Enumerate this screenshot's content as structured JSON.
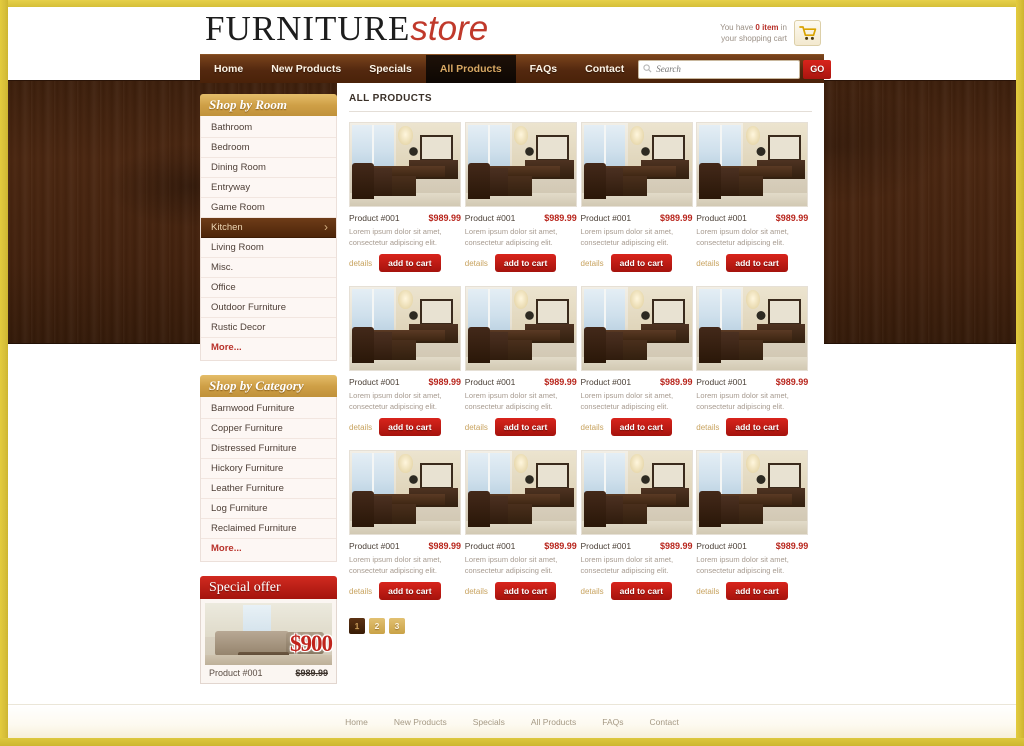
{
  "brand": {
    "part1": "FURNITURE",
    "part2": "store"
  },
  "cart": {
    "prefix": "You have",
    "count": "0 item",
    "suffix": "in your shopping cart",
    "icon": "shopping-cart-icon"
  },
  "nav": {
    "items": [
      {
        "label": "Home",
        "active": false
      },
      {
        "label": "New Products",
        "active": false
      },
      {
        "label": "Specials",
        "active": false
      },
      {
        "label": "All Products",
        "active": true
      },
      {
        "label": "FAQs",
        "active": false
      },
      {
        "label": "Contact",
        "active": false
      }
    ]
  },
  "search": {
    "placeholder": "Search",
    "value": "",
    "button": "GO",
    "icon": "magnifier-icon"
  },
  "sidebar": {
    "shop_by_room": {
      "title": "Shop by Room",
      "items": [
        {
          "label": "Bathroom",
          "active": false
        },
        {
          "label": "Bedroom",
          "active": false
        },
        {
          "label": "Dining Room",
          "active": false
        },
        {
          "label": "Entryway",
          "active": false
        },
        {
          "label": "Game Room",
          "active": false
        },
        {
          "label": "Kitchen",
          "active": true
        },
        {
          "label": "Living Room",
          "active": false
        },
        {
          "label": "Misc.",
          "active": false
        },
        {
          "label": "Office",
          "active": false
        },
        {
          "label": "Outdoor Furniture",
          "active": false
        },
        {
          "label": "Rustic Decor",
          "active": false
        },
        {
          "label": "More...",
          "active": false,
          "more": true
        }
      ]
    },
    "shop_by_category": {
      "title": "Shop by Category",
      "items": [
        {
          "label": "Barnwood Furniture",
          "active": false
        },
        {
          "label": "Copper Furniture",
          "active": false
        },
        {
          "label": "Distressed Furniture",
          "active": false
        },
        {
          "label": "Hickory Furniture",
          "active": false
        },
        {
          "label": "Leather Furniture",
          "active": false
        },
        {
          "label": "Log Furniture",
          "active": false
        },
        {
          "label": "Reclaimed Furniture",
          "active": false
        },
        {
          "label": "More...",
          "active": false,
          "more": true
        }
      ]
    },
    "special_offer": {
      "title": "Special offer",
      "sale_price": "$900",
      "product": "Product #001",
      "old_price": "$989.99",
      "image": "sofa-livingroom-photo"
    }
  },
  "content": {
    "title": "ALL PRODUCTS",
    "product_defaults": {
      "name": "Product #001",
      "price": "$989.99",
      "description": "Lorem ipsum dolor sit amet, consectetur adipiscing elit.",
      "details_label": "details",
      "cart_label": "add to cart",
      "image": "dining-room-photo"
    },
    "products": [
      {
        "name": "Product #001",
        "price": "$989.99",
        "description": "Lorem ipsum dolor sit amet, consectetur adipiscing elit.",
        "details_label": "details",
        "cart_label": "add to cart"
      },
      {
        "name": "Product #001",
        "price": "$989.99",
        "description": "Lorem ipsum dolor sit amet, consectetur adipiscing elit.",
        "details_label": "details",
        "cart_label": "add to cart"
      },
      {
        "name": "Product #001",
        "price": "$989.99",
        "description": "Lorem ipsum dolor sit amet, consectetur adipiscing elit.",
        "details_label": "details",
        "cart_label": "add to cart"
      },
      {
        "name": "Product #001",
        "price": "$989.99",
        "description": "Lorem ipsum dolor sit amet, consectetur adipiscing elit.",
        "details_label": "details",
        "cart_label": "add to cart"
      },
      {
        "name": "Product #001",
        "price": "$989.99",
        "description": "Lorem ipsum dolor sit amet, consectetur adipiscing elit.",
        "details_label": "details",
        "cart_label": "add to cart"
      },
      {
        "name": "Product #001",
        "price": "$989.99",
        "description": "Lorem ipsum dolor sit amet, consectetur adipiscing elit.",
        "details_label": "details",
        "cart_label": "add to cart"
      },
      {
        "name": "Product #001",
        "price": "$989.99",
        "description": "Lorem ipsum dolor sit amet, consectetur adipiscing elit.",
        "details_label": "details",
        "cart_label": "add to cart"
      },
      {
        "name": "Product #001",
        "price": "$989.99",
        "description": "Lorem ipsum dolor sit amet, consectetur adipiscing elit.",
        "details_label": "details",
        "cart_label": "add to cart"
      },
      {
        "name": "Product #001",
        "price": "$989.99",
        "description": "Lorem ipsum dolor sit amet, consectetur adipiscing elit.",
        "details_label": "details",
        "cart_label": "add to cart"
      },
      {
        "name": "Product #001",
        "price": "$989.99",
        "description": "Lorem ipsum dolor sit amet, consectetur adipiscing elit.",
        "details_label": "details",
        "cart_label": "add to cart"
      },
      {
        "name": "Product #001",
        "price": "$989.99",
        "description": "Lorem ipsum dolor sit amet, consectetur adipiscing elit.",
        "details_label": "details",
        "cart_label": "add to cart"
      },
      {
        "name": "Product #001",
        "price": "$989.99",
        "description": "Lorem ipsum dolor sit amet, consectetur adipiscing elit.",
        "details_label": "details",
        "cart_label": "add to cart"
      }
    ],
    "pagination": [
      {
        "label": "1",
        "active": true
      },
      {
        "label": "2",
        "active": false
      },
      {
        "label": "3",
        "active": false
      }
    ]
  },
  "footer": {
    "links": [
      "Home",
      "New Products",
      "Specials",
      "All Products",
      "FAQs",
      "Contact"
    ]
  },
  "colors": {
    "accent_red": "#b8251c",
    "nav_brown": "#53280f",
    "gold": "#c9a247",
    "frame_yellow": "#d8c03a",
    "wood": "#42210d"
  }
}
